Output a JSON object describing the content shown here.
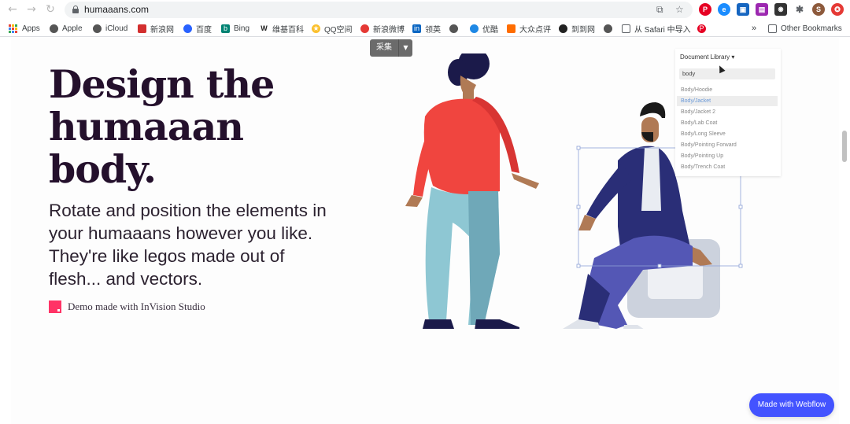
{
  "browser": {
    "url": "humaaans.com",
    "bookmarks": [
      "Apps",
      "Apple",
      "iCloud",
      "新浪网",
      "百度",
      "Bing",
      "维基百科",
      "QQ空间",
      "新浪微博",
      "领英",
      "优酷",
      "大众点评",
      "到到网",
      "从 Safari 中导入"
    ],
    "overflow_label": "»",
    "other_bookmarks": "Other Bookmarks",
    "profile_initial": "S"
  },
  "page": {
    "title": "Design the humaaan body.",
    "subtitle": "Rotate and position the elements in your humaaans however you like. They're like legos made out of flesh... and vectors.",
    "credit": "Demo made with InVision Studio",
    "caiji_label": "采集",
    "webflow_badge": "Made with Webflow",
    "doc_library": {
      "title": "Document Library ▾",
      "search_value": "body",
      "items": [
        "Body/Hoodie",
        "Body/Jacket",
        "Body/Jacket 2",
        "Body/Lab Coat",
        "Body/Long Sleeve",
        "Body/Pointing Forward",
        "Body/Pointing Up",
        "Body/Trench Coat"
      ],
      "selected": "Body/Jacket"
    }
  },
  "colors": {
    "title": "#24102c",
    "accent": "#4353ff",
    "credit_logo": "#ff3366"
  }
}
